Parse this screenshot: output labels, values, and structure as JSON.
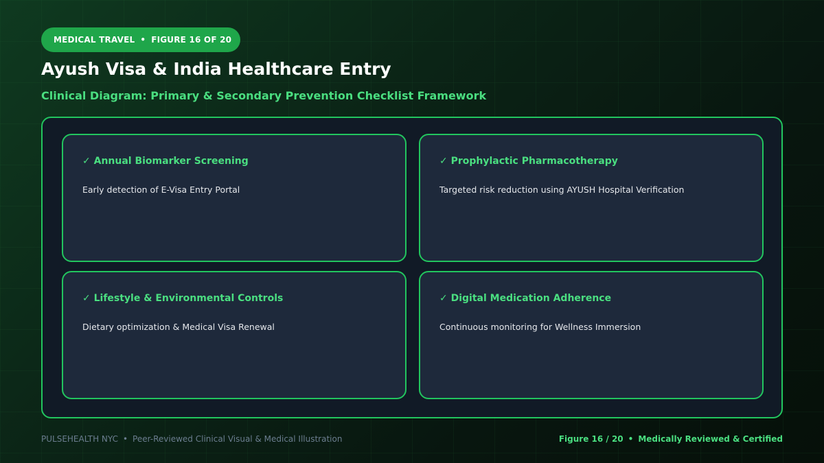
{
  "badge": {
    "category": "MEDICAL TRAVEL",
    "separator": "•",
    "figure": "FIGURE 16 OF 20"
  },
  "title": "Ayush Visa & India Healthcare Entry",
  "subtitle": "Clinical Diagram: Primary & Secondary Prevention Checklist Framework",
  "cards": [
    {
      "title": "✓ Annual Biomarker Screening",
      "body": "Early detection of E-Visa Entry Portal"
    },
    {
      "title": "✓ Prophylactic Pharmacotherapy",
      "body": "Targeted risk reduction using AYUSH Hospital Verification"
    },
    {
      "title": "✓ Lifestyle & Environmental Controls",
      "body": "Dietary optimization & Medical Visa Renewal"
    },
    {
      "title": "✓ Digital Medication Adherence",
      "body": "Continuous monitoring for Wellness Immersion"
    }
  ],
  "footer": {
    "brand": "PULSEHEALTH NYC",
    "separator": "•",
    "tagline": "Peer-Reviewed Clinical Visual & Medical Illustration",
    "figure": "Figure 16 / 20",
    "certification": "Medically Reviewed & Certified"
  },
  "colors": {
    "accent": "#22c55e",
    "accent_text": "#4ade80",
    "card_bg": "#1e293b",
    "badge_bg": "#1fa64a"
  }
}
